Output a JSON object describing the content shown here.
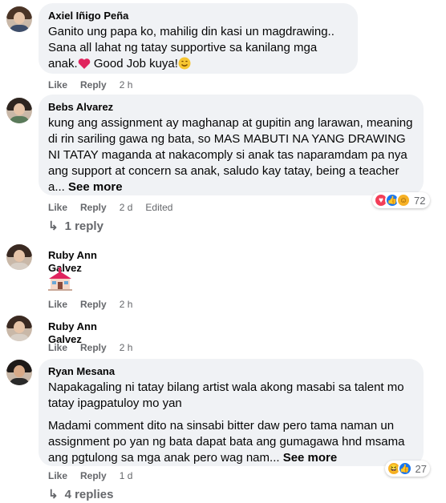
{
  "comments": [
    {
      "author": "Axiel Iñigo Peña",
      "lines": [
        "Ganito ung papa ko, mahilig din kasi un magdrawing..",
        "Sana all lahat ng tatay supportive sa kanilang mga anak.",
        " Good Job kuya!"
      ],
      "like": "Like",
      "reply": "Reply",
      "time": "2 h"
    },
    {
      "author": "Bebs Alvarez",
      "text": "kung ang assignment ay maghanap at gupitin ang larawan, meaning di rin sariling gawa ng bata, so MAS MABUTI NA YANG DRAWING NI TATAY maganda at nakacomply si anak tas naparamdam pa nya ang support at concern sa anak, saludo kay tatay, being a teacher a...",
      "see_more": "See more",
      "like": "Like",
      "reply": "Reply",
      "time": "2 d",
      "edited": "Edited",
      "reaction_count": "72",
      "reactions": [
        "love-icon",
        "like-icon",
        "care-icon"
      ],
      "replies": "1 reply"
    },
    {
      "author": "Ruby Ann Galvez",
      "sticker": "house-emoji",
      "like": "Like",
      "reply": "Reply",
      "time": "2 h"
    },
    {
      "author": "Ruby Ann Galvez",
      "like": "Like",
      "reply": "Reply",
      "time": "2 h"
    },
    {
      "author": "Ryan Mesana",
      "p1": "Napakagaling ni tatay bilang artist wala akong masabi sa talent mo tatay ipagpatuloy mo yan",
      "p2": "Madami comment dito na sinsabi bitter daw pero tama naman un assignment po yan ng bata dapat bata ang gumagawa hnd msama ang pgtulong sa mga anak pero wag nam...",
      "see_more": "See more",
      "like": "Like",
      "reply": "Reply",
      "time": "1 d",
      "reaction_count": "27",
      "reactions": [
        "haha-icon",
        "like-icon"
      ],
      "replies": "4 replies"
    }
  ],
  "colors": {
    "meta": "#65676b",
    "bubble": "#f0f2f5",
    "love": "#f33e58",
    "like": "#1877f2"
  }
}
